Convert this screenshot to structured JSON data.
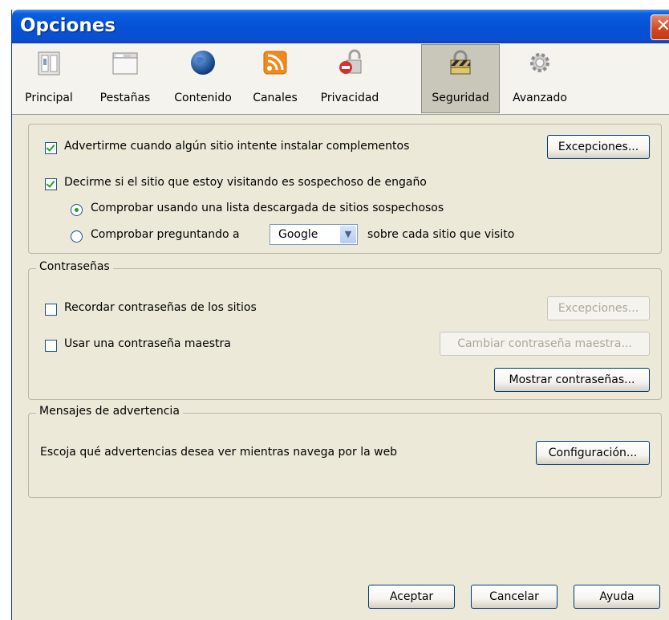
{
  "window": {
    "title": "Opciones",
    "close_label": "✕"
  },
  "tabs": [
    {
      "label": "Principal",
      "icon": "switch-icon"
    },
    {
      "label": "Pestañas",
      "icon": "tabs-window-icon"
    },
    {
      "label": "Contenido",
      "icon": "globe-icon"
    },
    {
      "label": "Canales",
      "icon": "rss-feed-icon"
    },
    {
      "label": "Privacidad",
      "icon": "privacy-lock-icon"
    },
    {
      "label": "Seguridad",
      "icon": "padlock-icon",
      "selected": true
    },
    {
      "label": "Avanzado",
      "icon": "gear-icon"
    }
  ],
  "security": {
    "warn_addons": {
      "label": "Advertirme cuando algún sitio intente instalar complementos",
      "checked": true
    },
    "exceptions_button": "Excepciones...",
    "phishing": {
      "label": "Decirme si el sitio que estoy visitando es sospechoso de engaño",
      "checked": true
    },
    "radio_list": {
      "label": "Comprobar usando una lista descargada de sitios sospechosos",
      "checked": true
    },
    "radio_ask": {
      "label_before": "Comprobar preguntando a",
      "label_after": "sobre cada sitio que visito",
      "checked": false
    },
    "provider_select": {
      "value": "Google"
    }
  },
  "passwords": {
    "legend": "Contraseñas",
    "remember": {
      "label": "Recordar contraseñas de los sitios",
      "checked": false
    },
    "exceptions_button": "Excepciones...",
    "master": {
      "label": "Usar una contraseña maestra",
      "checked": false
    },
    "change_master_button": "Cambiar contraseña maestra...",
    "show_passwords_button": "Mostrar contraseñas..."
  },
  "warnings": {
    "legend": "Mensajes de advertencia",
    "text": "Escoja qué advertencias desea ver mientras navega por la web",
    "settings_button": "Configuración..."
  },
  "footer": {
    "accept": "Aceptar",
    "cancel": "Cancelar",
    "help": "Ayuda"
  }
}
